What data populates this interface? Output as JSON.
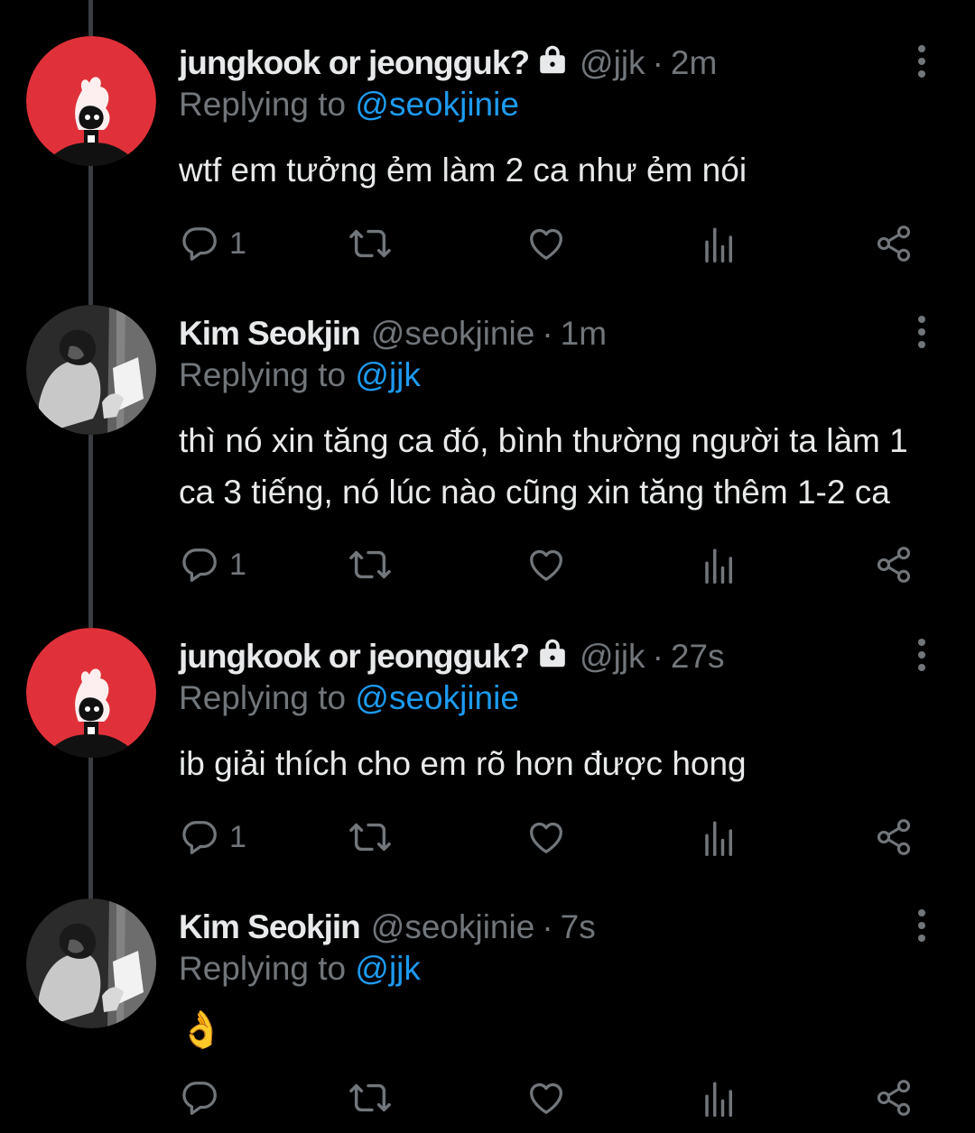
{
  "tweets": [
    {
      "display_name": "jungkook or jeongguk?",
      "protected": true,
      "handle": "@jjk",
      "time": "2m",
      "replying_prefix": "Replying to ",
      "replying_to": "@seokjinie",
      "lines": [
        "wtf em tưởng ẻm làm 2 ca như ẻm nói"
      ],
      "reply_count": "1",
      "avatar": "red-avatar"
    },
    {
      "display_name": "Kim Seokjin",
      "protected": false,
      "handle": "@seokjinie",
      "time": "1m",
      "replying_prefix": "Replying to ",
      "replying_to": "@jjk",
      "lines": [
        "thì nó xin tăng ca đó, bình thường người ta làm 1",
        "ca 3 tiếng, nó lúc nào cũng xin tăng thêm 1-2 ca"
      ],
      "reply_count": "1",
      "avatar": "grayscale-photo-avatar"
    },
    {
      "display_name": "jungkook or jeongguk?",
      "protected": true,
      "handle": "@jjk",
      "time": "27s",
      "replying_prefix": "Replying to ",
      "replying_to": "@seokjinie",
      "lines": [
        "ib giải thích cho em rõ hơn được hong"
      ],
      "reply_count": "1",
      "avatar": "red-avatar"
    },
    {
      "display_name": "Kim Seokjin",
      "protected": false,
      "handle": "@seokjinie",
      "time": "7s",
      "replying_prefix": "Replying to ",
      "replying_to": "@jjk",
      "lines": [
        "👌"
      ],
      "reply_count": "",
      "avatar": "grayscale-photo-avatar"
    }
  ],
  "separator": "·",
  "colors": {
    "background": "#000000",
    "text": "#e7e9ea",
    "secondary": "#71767b",
    "link": "#1d9bf0",
    "thread_line": "#3a3d41",
    "avatar_red": "#e0313a"
  },
  "icons": {
    "reply": "reply-icon",
    "retweet": "retweet-icon",
    "like": "heart-icon",
    "views": "views-icon",
    "share": "share-icon",
    "more": "more-icon",
    "lock": "lock-icon"
  }
}
